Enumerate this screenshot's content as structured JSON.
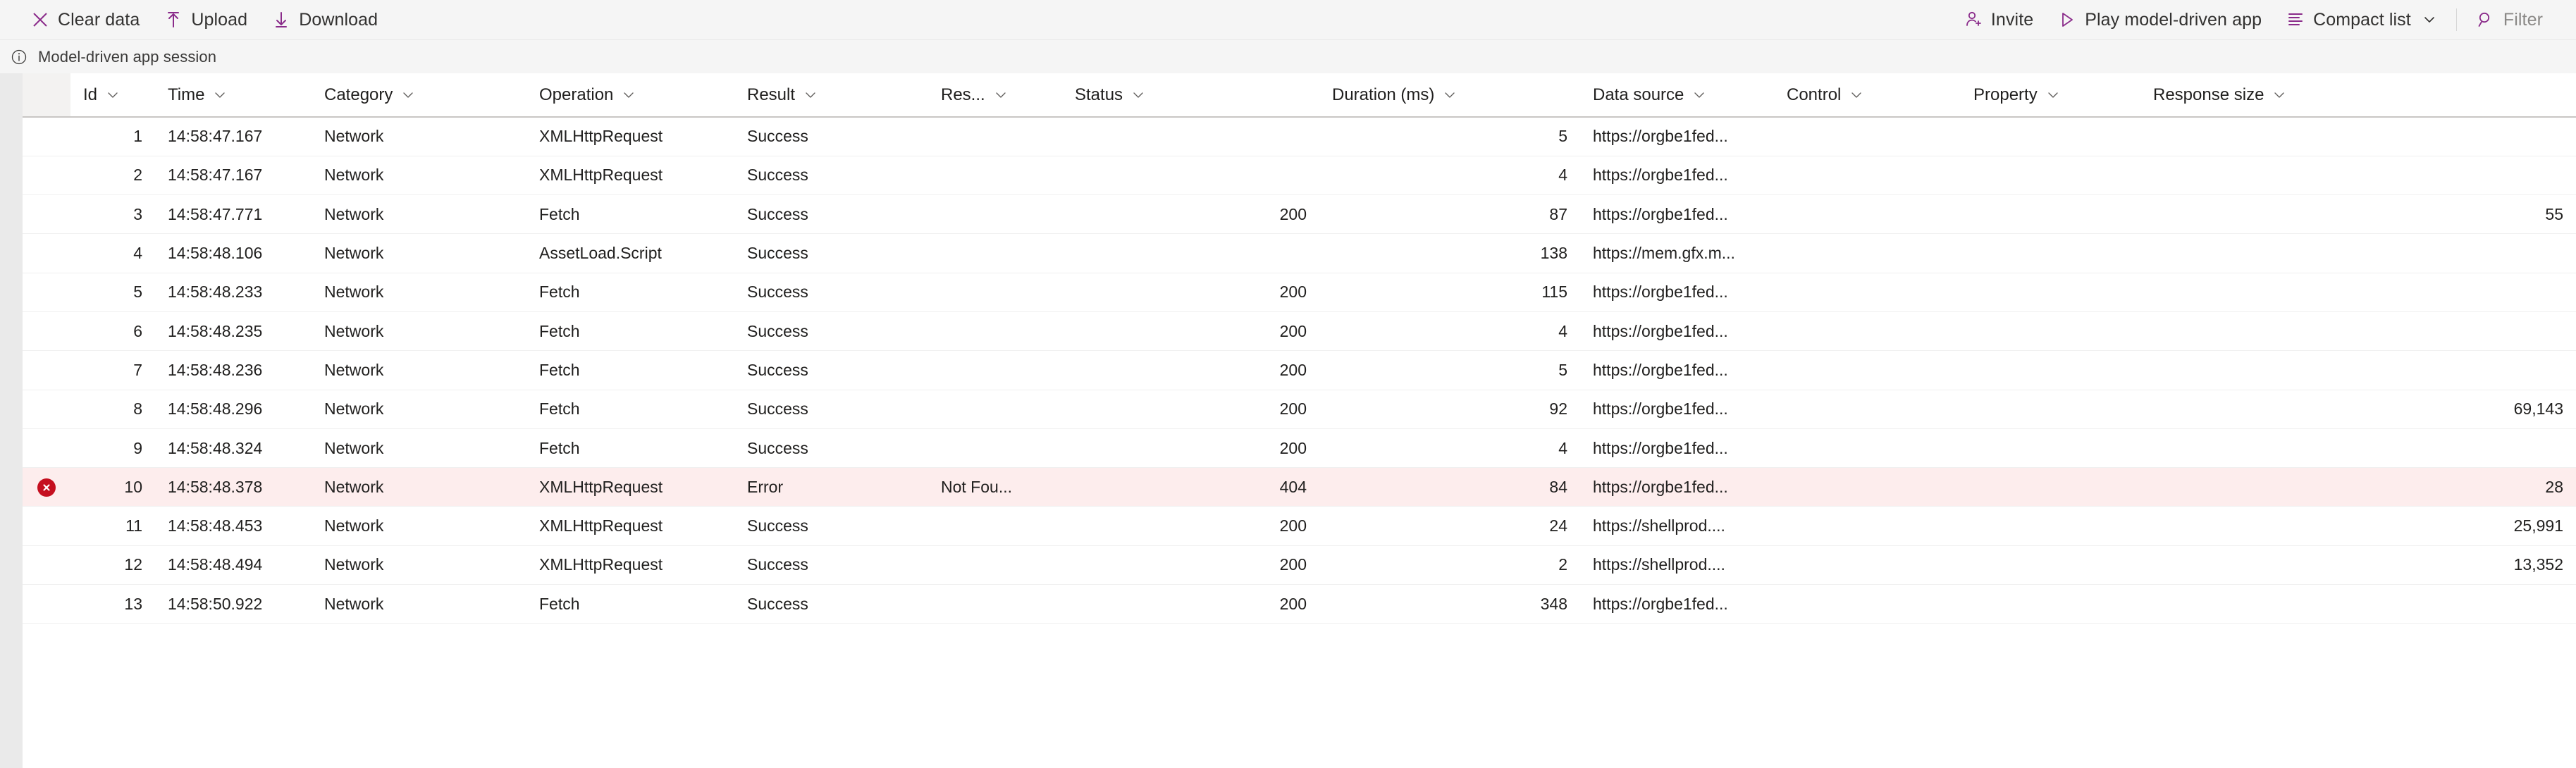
{
  "toolbar": {
    "left_buttons": [
      {
        "icon": "close-x-icon",
        "label": "Clear data"
      },
      {
        "icon": "upload-arrow-icon",
        "label": "Upload"
      },
      {
        "icon": "download-arrow-icon",
        "label": "Download"
      }
    ],
    "right_buttons": [
      {
        "icon": "invite-person-icon",
        "label": "Invite"
      },
      {
        "icon": "play-triangle-icon",
        "label": "Play model-driven app"
      },
      {
        "icon": "list-lines-icon",
        "label": "Compact list",
        "caret": "∨"
      },
      {
        "icon": "search-magnifier-icon",
        "label": "Filter"
      }
    ],
    "accent_color": "#8a2b8a",
    "muted_color": "#8a8886"
  },
  "infobar": {
    "icon": "info-circle-icon",
    "text": "Model-driven app session"
  },
  "table": {
    "columns": [
      {
        "key": "id",
        "label": "Id",
        "align": "right"
      },
      {
        "key": "time",
        "label": "Time",
        "align": "left"
      },
      {
        "key": "category",
        "label": "Category",
        "align": "left"
      },
      {
        "key": "operation",
        "label": "Operation",
        "align": "left"
      },
      {
        "key": "result",
        "label": "Result",
        "align": "left"
      },
      {
        "key": "res",
        "label": "Res...",
        "align": "left"
      },
      {
        "key": "status",
        "label": "Status",
        "align": "right"
      },
      {
        "key": "duration",
        "label": "Duration (ms)",
        "align": "right"
      },
      {
        "key": "data_source",
        "label": "Data source",
        "align": "left"
      },
      {
        "key": "control",
        "label": "Control",
        "align": "left"
      },
      {
        "key": "property",
        "label": "Property",
        "align": "left"
      },
      {
        "key": "response_size",
        "label": "Response size",
        "align": "right"
      }
    ],
    "sort_caret": "∨",
    "error_icon": "error-circle-x-icon",
    "error_row_bg": "#fdeded",
    "error_icon_color": "#c50f1f",
    "rows": [
      {
        "error": false,
        "id": "1",
        "time": "14:58:47.167",
        "category": "Network",
        "operation": "XMLHttpRequest",
        "result": "Success",
        "res": "",
        "status": "",
        "duration": "5",
        "data_source": "https://orgbe1fed...",
        "control": "",
        "property": "",
        "response_size": ""
      },
      {
        "error": false,
        "id": "2",
        "time": "14:58:47.167",
        "category": "Network",
        "operation": "XMLHttpRequest",
        "result": "Success",
        "res": "",
        "status": "",
        "duration": "4",
        "data_source": "https://orgbe1fed...",
        "control": "",
        "property": "",
        "response_size": ""
      },
      {
        "error": false,
        "id": "3",
        "time": "14:58:47.771",
        "category": "Network",
        "operation": "Fetch",
        "result": "Success",
        "res": "",
        "status": "200",
        "duration": "87",
        "data_source": "https://orgbe1fed...",
        "control": "",
        "property": "",
        "response_size": "55"
      },
      {
        "error": false,
        "id": "4",
        "time": "14:58:48.106",
        "category": "Network",
        "operation": "AssetLoad.Script",
        "result": "Success",
        "res": "",
        "status": "",
        "duration": "138",
        "data_source": "https://mem.gfx.m...",
        "control": "",
        "property": "",
        "response_size": ""
      },
      {
        "error": false,
        "id": "5",
        "time": "14:58:48.233",
        "category": "Network",
        "operation": "Fetch",
        "result": "Success",
        "res": "",
        "status": "200",
        "duration": "115",
        "data_source": "https://orgbe1fed...",
        "control": "",
        "property": "",
        "response_size": ""
      },
      {
        "error": false,
        "id": "6",
        "time": "14:58:48.235",
        "category": "Network",
        "operation": "Fetch",
        "result": "Success",
        "res": "",
        "status": "200",
        "duration": "4",
        "data_source": "https://orgbe1fed...",
        "control": "",
        "property": "",
        "response_size": ""
      },
      {
        "error": false,
        "id": "7",
        "time": "14:58:48.236",
        "category": "Network",
        "operation": "Fetch",
        "result": "Success",
        "res": "",
        "status": "200",
        "duration": "5",
        "data_source": "https://orgbe1fed...",
        "control": "",
        "property": "",
        "response_size": ""
      },
      {
        "error": false,
        "id": "8",
        "time": "14:58:48.296",
        "category": "Network",
        "operation": "Fetch",
        "result": "Success",
        "res": "",
        "status": "200",
        "duration": "92",
        "data_source": "https://orgbe1fed...",
        "control": "",
        "property": "",
        "response_size": "69,143"
      },
      {
        "error": false,
        "id": "9",
        "time": "14:58:48.324",
        "category": "Network",
        "operation": "Fetch",
        "result": "Success",
        "res": "",
        "status": "200",
        "duration": "4",
        "data_source": "https://orgbe1fed...",
        "control": "",
        "property": "",
        "response_size": ""
      },
      {
        "error": true,
        "id": "10",
        "time": "14:58:48.378",
        "category": "Network",
        "operation": "XMLHttpRequest",
        "result": "Error",
        "res": "Not Fou...",
        "status": "404",
        "duration": "84",
        "data_source": "https://orgbe1fed...",
        "control": "",
        "property": "",
        "response_size": "28"
      },
      {
        "error": false,
        "id": "11",
        "time": "14:58:48.453",
        "category": "Network",
        "operation": "XMLHttpRequest",
        "result": "Success",
        "res": "",
        "status": "200",
        "duration": "24",
        "data_source": "https://shellprod....",
        "control": "",
        "property": "",
        "response_size": "25,991"
      },
      {
        "error": false,
        "id": "12",
        "time": "14:58:48.494",
        "category": "Network",
        "operation": "XMLHttpRequest",
        "result": "Success",
        "res": "",
        "status": "200",
        "duration": "2",
        "data_source": "https://shellprod....",
        "control": "",
        "property": "",
        "response_size": "13,352"
      },
      {
        "error": false,
        "id": "13",
        "time": "14:58:50.922",
        "category": "Network",
        "operation": "Fetch",
        "result": "Success",
        "res": "",
        "status": "200",
        "duration": "348",
        "data_source": "https://orgbe1fed...",
        "control": "",
        "property": "",
        "response_size": ""
      }
    ]
  }
}
